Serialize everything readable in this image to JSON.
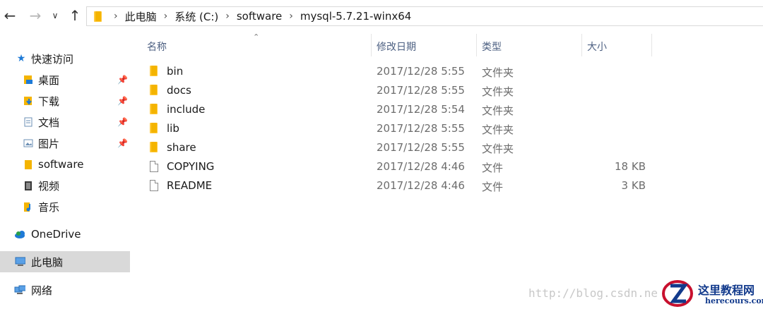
{
  "nav": {
    "back_icon": "arrow-left-icon",
    "forward_icon": "arrow-right-icon",
    "recent_icon": "chevron-down-icon",
    "up_icon": "arrow-up-icon"
  },
  "breadcrumb": [
    "此电脑",
    "系统 (C:)",
    "software",
    "mysql-5.7.21-winx64"
  ],
  "sidebar": {
    "quick_access": {
      "label": "快速访问",
      "icon": "star-icon"
    },
    "items": [
      {
        "label": "桌面",
        "icon": "desktop-icon",
        "pinned": true
      },
      {
        "label": "下载",
        "icon": "download-icon",
        "pinned": true
      },
      {
        "label": "文档",
        "icon": "document-icon",
        "pinned": true
      },
      {
        "label": "图片",
        "icon": "picture-icon",
        "pinned": true
      },
      {
        "label": "software",
        "icon": "folder-icon",
        "pinned": false
      },
      {
        "label": "视频",
        "icon": "video-icon",
        "pinned": false
      },
      {
        "label": "音乐",
        "icon": "music-icon",
        "pinned": false
      }
    ],
    "onedrive": {
      "label": "OneDrive",
      "icon": "cloud-icon"
    },
    "this_pc": {
      "label": "此电脑",
      "icon": "computer-icon",
      "selected": true
    },
    "network": {
      "label": "网络",
      "icon": "network-icon"
    }
  },
  "columns": {
    "name": "名称",
    "modified": "修改日期",
    "type": "类型",
    "size": "大小"
  },
  "files": [
    {
      "name": "bin",
      "modified": "2017/12/28 5:55",
      "type": "文件夹",
      "size": "",
      "kind": "folder"
    },
    {
      "name": "docs",
      "modified": "2017/12/28 5:55",
      "type": "文件夹",
      "size": "",
      "kind": "folder"
    },
    {
      "name": "include",
      "modified": "2017/12/28 5:54",
      "type": "文件夹",
      "size": "",
      "kind": "folder"
    },
    {
      "name": "lib",
      "modified": "2017/12/28 5:55",
      "type": "文件夹",
      "size": "",
      "kind": "folder"
    },
    {
      "name": "share",
      "modified": "2017/12/28 5:55",
      "type": "文件夹",
      "size": "",
      "kind": "folder"
    },
    {
      "name": "COPYING",
      "modified": "2017/12/28 4:46",
      "type": "文件",
      "size": "18 KB",
      "kind": "file"
    },
    {
      "name": "README",
      "modified": "2017/12/28 4:46",
      "type": "文件",
      "size": "3 KB",
      "kind": "file"
    }
  ],
  "watermark": "http://blog.csdn.ne",
  "logo": {
    "title": "这里教程网",
    "subtitle": "herecours.com"
  },
  "colors": {
    "folder": "#f4b400",
    "selected_bg": "#d9d9d9",
    "header_text": "#4d6082",
    "accent_blue": "#1e7ad6",
    "logo_red": "#c8102e",
    "logo_blue": "#123a8c"
  }
}
